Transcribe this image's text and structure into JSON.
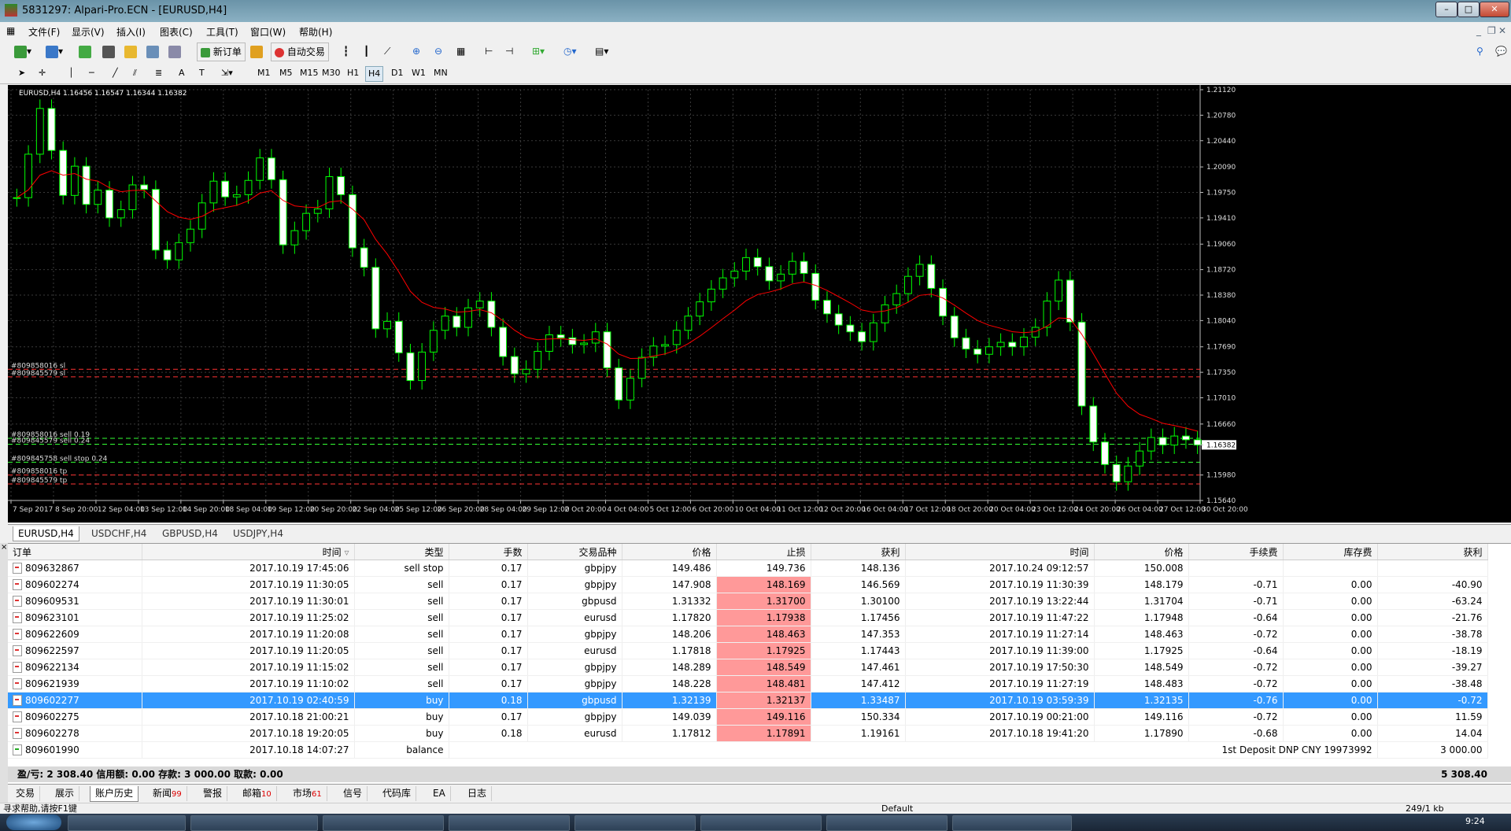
{
  "window": {
    "title": "5831297: Alpari-Pro.ECN - [EURUSD,H4]"
  },
  "menu": [
    "文件(F)",
    "显示(V)",
    "插入(I)",
    "图表(C)",
    "工具(T)",
    "窗口(W)",
    "帮助(H)"
  ],
  "toolbar": {
    "new_order": "新订单",
    "auto_trading": "自动交易"
  },
  "timeframes": [
    "M1",
    "M5",
    "M15",
    "M30",
    "H1",
    "H4",
    "D1",
    "W1",
    "MN"
  ],
  "active_timeframe": "H4",
  "chart_data": {
    "type": "candlestick",
    "header": "EURUSD,H4  1.16456 1.16547 1.16344 1.16382",
    "y_ticks": [
      "1.21120",
      "1.20780",
      "1.20440",
      "1.20090",
      "1.19750",
      "1.19410",
      "1.19060",
      "1.18720",
      "1.18380",
      "1.18040",
      "1.17690",
      "1.17350",
      "1.17010",
      "1.16660",
      "1.16382",
      "1.15980",
      "1.15640"
    ],
    "x_ticks": [
      "7 Sep 2017",
      "8 Sep 20:00",
      "12 Sep 04:00",
      "13 Sep 12:00",
      "14 Sep 20:00",
      "18 Sep 04:00",
      "19 Sep 12:00",
      "20 Sep 20:00",
      "22 Sep 04:00",
      "25 Sep 12:00",
      "26 Sep 20:00",
      "28 Sep 04:00",
      "29 Sep 12:00",
      "2 Oct 20:00",
      "4 Oct 04:00",
      "5 Oct 12:00",
      "6 Oct 20:00",
      "10 Oct 04:00",
      "11 Oct 12:00",
      "12 Oct 20:00",
      "16 Oct 04:00",
      "17 Oct 12:00",
      "18 Oct 20:00",
      "20 Oct 04:00",
      "23 Oct 12:00",
      "24 Oct 20:00",
      "26 Oct 04:00",
      "27 Oct 12:00",
      "30 Oct 20:00"
    ],
    "ylim": [
      1.1564,
      1.2112
    ],
    "current_price": 1.16382,
    "close_path": [
      1.1968,
      1.2026,
      1.2087,
      1.2031,
      1.1971,
      1.201,
      1.1959,
      1.1978,
      1.1941,
      1.1952,
      1.1985,
      1.1979,
      1.1898,
      1.1885,
      1.1908,
      1.1926,
      1.1961,
      1.199,
      1.1969,
      1.1972,
      1.1991,
      1.2021,
      1.1992,
      1.1905,
      1.1924,
      1.1947,
      1.1953,
      1.1996,
      1.1972,
      1.1901,
      1.1875,
      1.1793,
      1.1803,
      1.1761,
      1.1724,
      1.1762,
      1.1791,
      1.181,
      1.1795,
      1.1821,
      1.183,
      1.1795,
      1.1756,
      1.1733,
      1.1739,
      1.1763,
      1.1785,
      1.1781,
      1.1772,
      1.1774,
      1.1789,
      1.1741,
      1.1698,
      1.1727,
      1.1755,
      1.177,
      1.1772,
      1.1791,
      1.181,
      1.1829,
      1.1846,
      1.1861,
      1.187,
      1.1888,
      1.1876,
      1.1857,
      1.1866,
      1.1883,
      1.1867,
      1.1831,
      1.1813,
      1.1798,
      1.1789,
      1.1776,
      1.1801,
      1.1825,
      1.184,
      1.1863,
      1.1879,
      1.1847,
      1.181,
      1.1781,
      1.1766,
      1.1759,
      1.1769,
      1.1775,
      1.1769,
      1.1782,
      1.1795,
      1.183,
      1.1858,
      1.1802,
      1.169,
      1.1642,
      1.1612,
      1.1589,
      1.161,
      1.163,
      1.1648,
      1.1638,
      1.165,
      1.1645,
      1.1638
    ],
    "moving_average_color": "#ff0000",
    "candle_color": "#00ff00",
    "background": "#000000",
    "lines": [
      {
        "label": "#809858016 sl",
        "price": 1.1739,
        "color": "#ff3333"
      },
      {
        "label": "#809845579 sl",
        "price": 1.1729,
        "color": "#ff3333"
      },
      {
        "label": "#809858016 sell 0.19",
        "price": 1.1647,
        "color": "#33ff33"
      },
      {
        "label": "#809845579 sell 0.24",
        "price": 1.1639,
        "color": "#33ff33"
      },
      {
        "label": "#809845758 sell stop 0.24",
        "price": 1.1615,
        "color": "#33ff33"
      },
      {
        "label": "#809858016 tp",
        "price": 1.1598,
        "color": "#ff3333"
      },
      {
        "label": "#809845579 tp",
        "price": 1.1586,
        "color": "#ff3333"
      }
    ]
  },
  "chart_tabs": [
    "EURUSD,H4",
    "USDCHF,H4",
    "GBPUSD,H4",
    "USDJPY,H4"
  ],
  "history": {
    "columns": [
      "订单",
      "时间",
      "类型",
      "手数",
      "交易品种",
      "价格",
      "止损",
      "获利",
      "时间",
      "价格",
      "手续费",
      "库存费",
      "获利"
    ],
    "rows": [
      {
        "order": "809632867",
        "open_time": "2017.10.19 17:45:06",
        "type": "sell stop",
        "lots": "0.17",
        "symbol": "gbpjpy",
        "price": "149.486",
        "sl": "149.736",
        "tp": "148.136",
        "close_time": "2017.10.24 09:12:57",
        "close_price": "150.008",
        "commission": "",
        "swap": "",
        "profit": ""
      },
      {
        "order": "809602274",
        "open_time": "2017.10.19 11:30:05",
        "type": "sell",
        "lots": "0.17",
        "symbol": "gbpjpy",
        "price": "147.908",
        "sl": "148.169",
        "tp": "146.569",
        "close_time": "2017.10.19 11:30:39",
        "close_price": "148.179",
        "commission": "-0.71",
        "swap": "0.00",
        "profit": "-40.90"
      },
      {
        "order": "809609531",
        "open_time": "2017.10.19 11:30:01",
        "type": "sell",
        "lots": "0.17",
        "symbol": "gbpusd",
        "price": "1.31332",
        "sl": "1.31700",
        "tp": "1.30100",
        "close_time": "2017.10.19 13:22:44",
        "close_price": "1.31704",
        "commission": "-0.71",
        "swap": "0.00",
        "profit": "-63.24"
      },
      {
        "order": "809623101",
        "open_time": "2017.10.19 11:25:02",
        "type": "sell",
        "lots": "0.17",
        "symbol": "eurusd",
        "price": "1.17820",
        "sl": "1.17938",
        "tp": "1.17456",
        "close_time": "2017.10.19 11:47:22",
        "close_price": "1.17948",
        "commission": "-0.64",
        "swap": "0.00",
        "profit": "-21.76"
      },
      {
        "order": "809622609",
        "open_time": "2017.10.19 11:20:08",
        "type": "sell",
        "lots": "0.17",
        "symbol": "gbpjpy",
        "price": "148.206",
        "sl": "148.463",
        "tp": "147.353",
        "close_time": "2017.10.19 11:27:14",
        "close_price": "148.463",
        "commission": "-0.72",
        "swap": "0.00",
        "profit": "-38.78"
      },
      {
        "order": "809622597",
        "open_time": "2017.10.19 11:20:05",
        "type": "sell",
        "lots": "0.17",
        "symbol": "eurusd",
        "price": "1.17818",
        "sl": "1.17925",
        "tp": "1.17443",
        "close_time": "2017.10.19 11:39:00",
        "close_price": "1.17925",
        "commission": "-0.64",
        "swap": "0.00",
        "profit": "-18.19"
      },
      {
        "order": "809622134",
        "open_time": "2017.10.19 11:15:02",
        "type": "sell",
        "lots": "0.17",
        "symbol": "gbpjpy",
        "price": "148.289",
        "sl": "148.549",
        "tp": "147.461",
        "close_time": "2017.10.19 17:50:30",
        "close_price": "148.549",
        "commission": "-0.72",
        "swap": "0.00",
        "profit": "-39.27"
      },
      {
        "order": "809621939",
        "open_time": "2017.10.19 11:10:02",
        "type": "sell",
        "lots": "0.17",
        "symbol": "gbpjpy",
        "price": "148.228",
        "sl": "148.481",
        "tp": "147.412",
        "close_time": "2017.10.19 11:27:19",
        "close_price": "148.483",
        "commission": "-0.72",
        "swap": "0.00",
        "profit": "-38.48"
      },
      {
        "order": "809602277",
        "open_time": "2017.10.19 02:40:59",
        "type": "buy",
        "lots": "0.18",
        "symbol": "gbpusd",
        "price": "1.32139",
        "sl": "1.32137",
        "tp": "1.33487",
        "close_time": "2017.10.19 03:59:39",
        "close_price": "1.32135",
        "commission": "-0.76",
        "swap": "0.00",
        "profit": "-0.72",
        "selected": true
      },
      {
        "order": "809602275",
        "open_time": "2017.10.18 21:00:21",
        "type": "buy",
        "lots": "0.17",
        "symbol": "gbpjpy",
        "price": "149.039",
        "sl": "149.116",
        "tp": "150.334",
        "close_time": "2017.10.19 00:21:00",
        "close_price": "149.116",
        "commission": "-0.72",
        "swap": "0.00",
        "profit": "11.59"
      },
      {
        "order": "809602278",
        "open_time": "2017.10.18 19:20:05",
        "type": "buy",
        "lots": "0.18",
        "symbol": "eurusd",
        "price": "1.17812",
        "sl": "1.17891",
        "tp": "1.19161",
        "close_time": "2017.10.18 19:41:20",
        "close_price": "1.17890",
        "commission": "-0.68",
        "swap": "0.00",
        "profit": "14.04"
      }
    ],
    "balance_row": {
      "order": "809601990",
      "open_time": "2017.10.18 14:07:27",
      "type": "balance",
      "comment": "1st Deposit DNP CNY 19973992",
      "profit": "3 000.00"
    },
    "summary": "盈/亏: 2 308.40  信用额: 0.00  存款: 3 000.00  取款: 0.00",
    "summary_total": "5 308.40"
  },
  "bottom_tabs": [
    {
      "label": "交易",
      "badge": ""
    },
    {
      "label": "展示",
      "badge": ""
    },
    {
      "label": "账户历史",
      "badge": "",
      "active": true
    },
    {
      "label": "新闻",
      "badge": "99"
    },
    {
      "label": "警报",
      "badge": ""
    },
    {
      "label": "邮箱",
      "badge": "10"
    },
    {
      "label": "市场",
      "badge": "61"
    },
    {
      "label": "信号",
      "badge": ""
    },
    {
      "label": "代码库",
      "badge": ""
    },
    {
      "label": "EA",
      "badge": ""
    },
    {
      "label": "日志",
      "badge": ""
    }
  ],
  "status": {
    "help": "寻求帮助,请按F1键",
    "profile": "Default",
    "traffic": "249/1 kb"
  },
  "clock": "9:24"
}
